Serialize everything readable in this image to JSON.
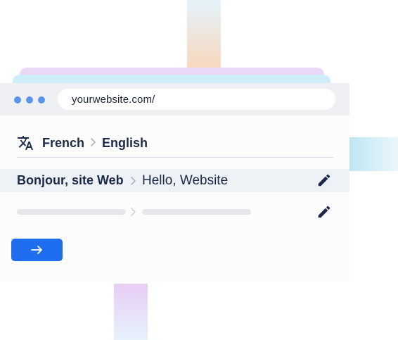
{
  "browser": {
    "url": "yourwebsite.com/"
  },
  "translator": {
    "source_language": "French",
    "target_language": "English",
    "rows": [
      {
        "source": "Bonjour, site Web",
        "translation": "Hello, Website"
      }
    ]
  },
  "icons": {
    "window_dots": "window-control-dots",
    "language": "translate-icon",
    "separator": "chevron-right-icon",
    "edit": "pencil-icon",
    "submit": "arrow-right-icon"
  },
  "colors": {
    "accent": "#1f6ef0",
    "text": "#1a2a48",
    "dots": "#5b93ec"
  }
}
